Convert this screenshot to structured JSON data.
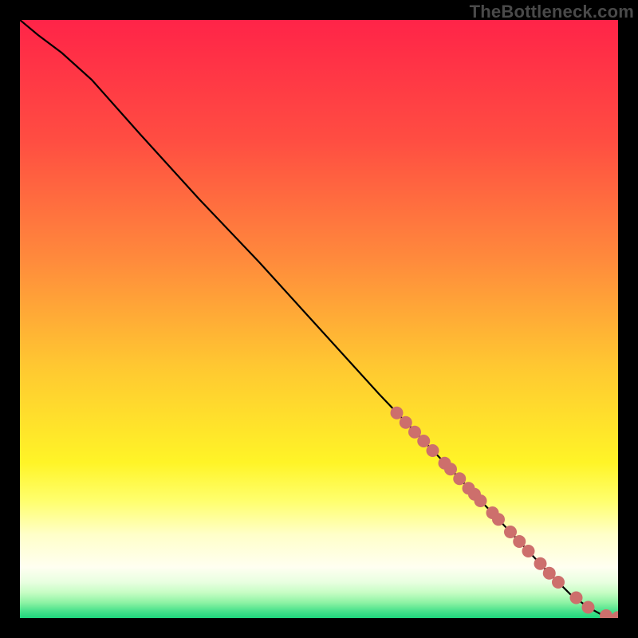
{
  "watermark": "TheBottleneck.com",
  "colors": {
    "background": "#000000",
    "curve": "#000000",
    "marker_fill": "#CD6F6C",
    "marker_stroke": "rgba(0,0,0,0)"
  },
  "chart_data": {
    "type": "line",
    "title": "",
    "xlabel": "",
    "ylabel": "",
    "xlim": [
      0,
      100
    ],
    "ylim": [
      0,
      100
    ],
    "grid": false,
    "legend": false,
    "gradient_stops": [
      {
        "offset": 0.0,
        "color": "#FF2448"
      },
      {
        "offset": 0.2,
        "color": "#FF4D42"
      },
      {
        "offset": 0.4,
        "color": "#FF8A3C"
      },
      {
        "offset": 0.58,
        "color": "#FFC831"
      },
      {
        "offset": 0.74,
        "color": "#FFF427"
      },
      {
        "offset": 0.805,
        "color": "#FFFF6E"
      },
      {
        "offset": 0.86,
        "color": "#FFFFC8"
      },
      {
        "offset": 0.915,
        "color": "#FFFFF1"
      },
      {
        "offset": 0.94,
        "color": "#E8FFE0"
      },
      {
        "offset": 0.958,
        "color": "#C5FDC3"
      },
      {
        "offset": 0.974,
        "color": "#8EF3A4"
      },
      {
        "offset": 0.988,
        "color": "#4AE28C"
      },
      {
        "offset": 1.0,
        "color": "#1FD67D"
      }
    ],
    "series": [
      {
        "name": "bottleneck-curve",
        "x": [
          0,
          3,
          7,
          12,
          20,
          30,
          40,
          50,
          60,
          70,
          80,
          88,
          92,
          95,
          97,
          98.5,
          100
        ],
        "y": [
          100,
          97.5,
          94.5,
          90,
          81,
          70,
          59.5,
          48.5,
          37.5,
          27,
          16.5,
          8,
          4,
          1.8,
          0.7,
          0.25,
          0.1
        ]
      }
    ],
    "markers": {
      "name": "highlighted-points",
      "x": [
        63,
        64.5,
        66,
        67.5,
        69,
        71,
        72,
        73.5,
        75,
        76,
        77,
        79,
        80,
        82,
        83.5,
        85,
        87,
        88.5,
        90,
        93,
        95,
        98,
        100
      ],
      "y": [
        34.3,
        32.7,
        31.1,
        29.6,
        28.0,
        25.9,
        24.9,
        23.3,
        21.7,
        20.7,
        19.6,
        17.6,
        16.5,
        14.4,
        12.8,
        11.2,
        9.1,
        7.5,
        6.0,
        3.4,
        1.8,
        0.4,
        0.1
      ]
    }
  }
}
